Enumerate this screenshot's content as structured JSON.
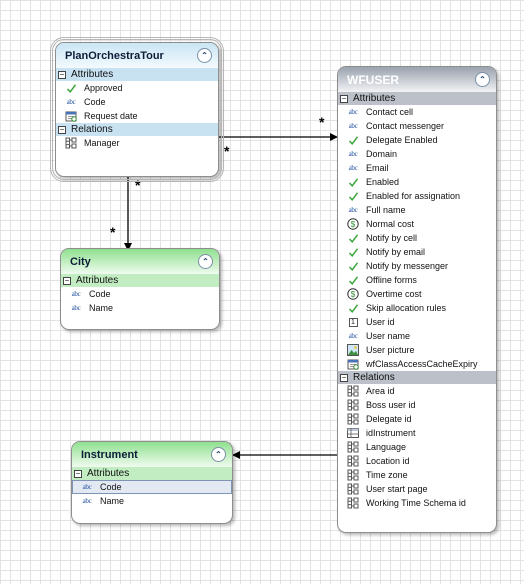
{
  "plan": {
    "title": "PlanOrchestraTour",
    "attributes_label": "Attributes",
    "attributes": [
      {
        "name": "Approved",
        "icon": "check"
      },
      {
        "name": "Code",
        "icon": "abc"
      },
      {
        "name": "Request date",
        "icon": "calendar"
      }
    ],
    "relations_label": "Relations",
    "relations": [
      {
        "name": "Manager",
        "icon": "relation"
      }
    ]
  },
  "wfuser": {
    "title": "WFUSER",
    "attributes_label": "Attributes",
    "attributes": [
      {
        "name": "Contact cell",
        "icon": "abc"
      },
      {
        "name": "Contact messenger",
        "icon": "abc"
      },
      {
        "name": "Delegate Enabled",
        "icon": "check"
      },
      {
        "name": "Domain",
        "icon": "abc"
      },
      {
        "name": "Email",
        "icon": "abc"
      },
      {
        "name": "Enabled",
        "icon": "check"
      },
      {
        "name": "Enabled for assignation",
        "icon": "check"
      },
      {
        "name": "Full name",
        "icon": "abc"
      },
      {
        "name": "Normal cost",
        "icon": "currency"
      },
      {
        "name": "Notify by cell",
        "icon": "check"
      },
      {
        "name": "Notify by email",
        "icon": "check"
      },
      {
        "name": "Notify by messenger",
        "icon": "check"
      },
      {
        "name": "Offline forms",
        "icon": "check"
      },
      {
        "name": "Overtime cost",
        "icon": "currency"
      },
      {
        "name": "Skip allocation rules",
        "icon": "check"
      },
      {
        "name": "User id",
        "icon": "number"
      },
      {
        "name": "User name",
        "icon": "abc"
      },
      {
        "name": "User picture",
        "icon": "image"
      },
      {
        "name": "wfClassAccessCacheExpiry",
        "icon": "calendar"
      }
    ],
    "relations_label": "Relations",
    "relations": [
      {
        "name": "Area id",
        "icon": "relation"
      },
      {
        "name": "Boss user id",
        "icon": "relation"
      },
      {
        "name": "Delegate id",
        "icon": "relation"
      },
      {
        "name": "idInstrument",
        "icon": "table"
      },
      {
        "name": "Language",
        "icon": "relation"
      },
      {
        "name": "Location id",
        "icon": "relation"
      },
      {
        "name": "Time zone",
        "icon": "relation"
      },
      {
        "name": "User start page",
        "icon": "relation"
      },
      {
        "name": "Working Time Schema id",
        "icon": "relation"
      }
    ]
  },
  "city": {
    "title": "City",
    "attributes_label": "Attributes",
    "attributes": [
      {
        "name": "Code",
        "icon": "abc"
      },
      {
        "name": "Name",
        "icon": "abc"
      }
    ]
  },
  "instrument": {
    "title": "Instrument",
    "attributes_label": "Attributes",
    "attributes": [
      {
        "name": "Code",
        "icon": "abc",
        "selected": true
      },
      {
        "name": "Name",
        "icon": "abc"
      }
    ]
  },
  "connectors": {
    "plan_wf_at_wf": "*",
    "plan_wf_at_plan": "*",
    "plan_city_at_plan": "*",
    "plan_city_at_city": "*"
  },
  "colors": {
    "plan_header": "#c9e5f5",
    "wf_header": "#9aa2ae",
    "green_header": "#8ee08e"
  }
}
